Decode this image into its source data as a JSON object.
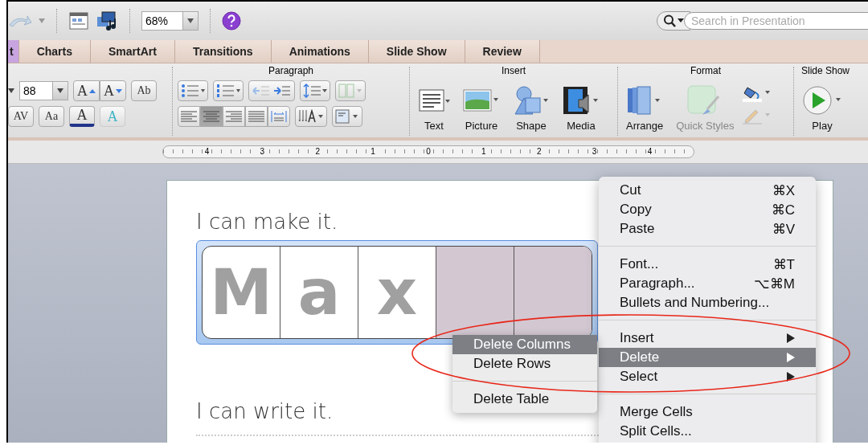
{
  "toolbar": {
    "zoom": "68%",
    "search": {
      "placeholder": "Search in Presentation"
    }
  },
  "tabs": [
    {
      "label": "t",
      "selected": true
    },
    {
      "label": "Charts",
      "selected": false
    },
    {
      "label": "SmartArt",
      "selected": false
    },
    {
      "label": "Transitions",
      "selected": false
    },
    {
      "label": "Animations",
      "selected": false
    },
    {
      "label": "Slide Show",
      "selected": false
    },
    {
      "label": "Review",
      "selected": false
    }
  ],
  "ribbon": {
    "font": {
      "size": "88",
      "buttons": [
        {
          "kind": "grow",
          "glyph": "A"
        },
        {
          "kind": "shrink",
          "glyph": "A"
        },
        {
          "kind": "clear",
          "glyph": "Ab"
        },
        {
          "kind": "spacing",
          "glyph": "AV"
        },
        {
          "kind": "case",
          "glyph": "Aa"
        },
        {
          "kind": "color",
          "glyph": "A"
        },
        {
          "kind": "effects",
          "glyph": "A"
        }
      ]
    },
    "paragraph": {
      "title": "Paragraph",
      "align": [
        {
          "kind": "left",
          "selected": false
        },
        {
          "kind": "center",
          "selected": true
        },
        {
          "kind": "right",
          "selected": false
        },
        {
          "kind": "justify",
          "selected": false
        },
        {
          "kind": "distributed",
          "selected": false
        }
      ]
    },
    "insert": {
      "title": "Insert",
      "buttons": [
        {
          "kind": "text",
          "label": "Text"
        },
        {
          "kind": "picture",
          "label": "Picture"
        },
        {
          "kind": "shape",
          "label": "Shape"
        },
        {
          "kind": "media",
          "label": "Media"
        }
      ]
    },
    "format": {
      "title": "Format",
      "buttons": [
        {
          "kind": "arrange",
          "label": "Arrange",
          "disabled": false
        },
        {
          "kind": "styles",
          "label": "Quick Styles",
          "disabled": true
        }
      ]
    },
    "slideshow": {
      "title": "Slide Show",
      "play": "Play"
    }
  },
  "ruler": [
    "4",
    "3",
    "2",
    "1",
    "0",
    "1",
    "2",
    "3",
    "4"
  ],
  "slide": {
    "heading_1": "I can make it.",
    "cells": [
      {
        "letter": "M",
        "selected": false
      },
      {
        "letter": "a",
        "selected": false
      },
      {
        "letter": "x",
        "selected": false
      },
      {
        "selected": true
      },
      {
        "selected": true
      }
    ],
    "heading_2": "I can write it."
  },
  "context_menu": {
    "sections": [
      [
        {
          "label": "Cut",
          "shortcut": "⌘X",
          "submenu": false,
          "selected": false
        },
        {
          "label": "Copy",
          "shortcut": "⌘C",
          "submenu": false,
          "selected": false
        },
        {
          "label": "Paste",
          "shortcut": "⌘V",
          "submenu": false,
          "selected": false
        }
      ],
      [
        {
          "label": "Font...",
          "shortcut": "⌘T",
          "submenu": false,
          "selected": false
        },
        {
          "label": "Paragraph...",
          "shortcut": "⌥⌘M",
          "submenu": false,
          "selected": false
        },
        {
          "label": "Bullets and Numbering...",
          "submenu": false,
          "selected": false
        }
      ],
      [
        {
          "label": "Insert",
          "submenu": true,
          "selected": false
        },
        {
          "label": "Delete",
          "submenu": true,
          "selected": true
        },
        {
          "label": "Select",
          "submenu": true,
          "selected": false
        }
      ],
      [
        {
          "label": "Merge Cells",
          "submenu": false,
          "selected": false
        },
        {
          "label": "Split Cells...",
          "submenu": false,
          "selected": false
        }
      ]
    ]
  },
  "submenu": {
    "sections": [
      [
        {
          "label": "Delete Columns",
          "selected": true
        },
        {
          "label": "Delete Rows",
          "selected": false
        }
      ],
      [
        {
          "label": "Delete Table",
          "selected": false
        }
      ]
    ]
  }
}
